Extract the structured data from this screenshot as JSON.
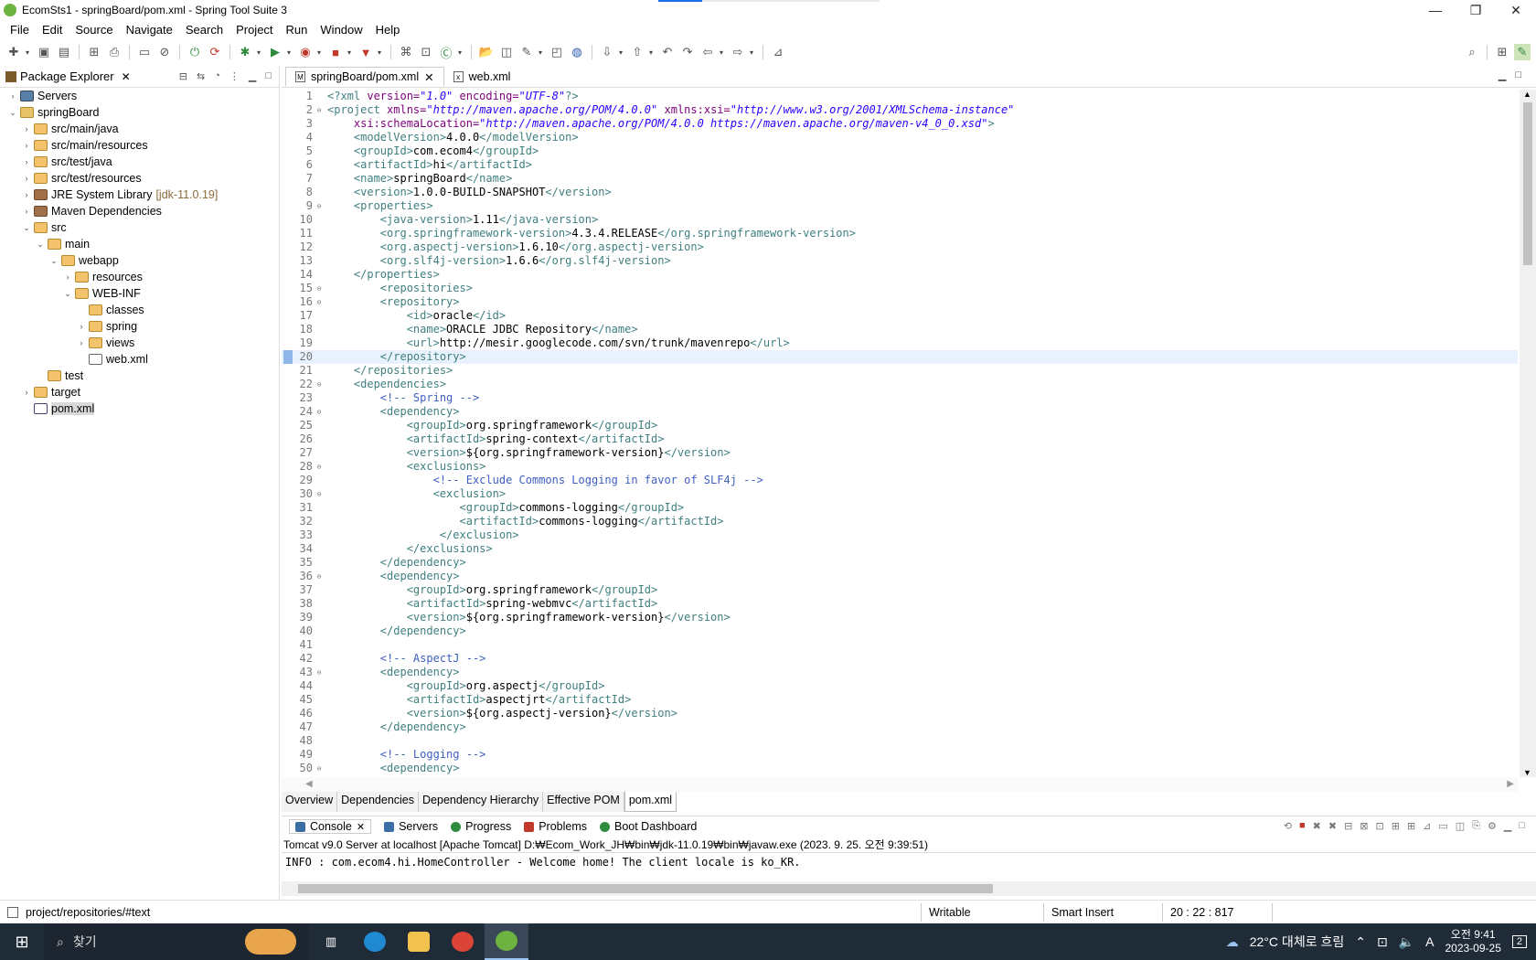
{
  "window": {
    "title": "EcomSts1 - springBoard/pom.xml - Spring Tool Suite 3"
  },
  "menu": [
    "File",
    "Edit",
    "Source",
    "Navigate",
    "Search",
    "Project",
    "Run",
    "Window",
    "Help"
  ],
  "package_explorer": {
    "title": "Package Explorer",
    "tree": [
      {
        "label": "Servers",
        "indent": 0,
        "arrow": "›",
        "icon": "srv"
      },
      {
        "label": "springBoard",
        "indent": 0,
        "arrow": "⌄",
        "icon": "proj"
      },
      {
        "label": "src/main/java",
        "indent": 1,
        "arrow": "›",
        "icon": "folder"
      },
      {
        "label": "src/main/resources",
        "indent": 1,
        "arrow": "›",
        "icon": "folder"
      },
      {
        "label": "src/test/java",
        "indent": 1,
        "arrow": "›",
        "icon": "folder"
      },
      {
        "label": "src/test/resources",
        "indent": 1,
        "arrow": "›",
        "icon": "folder"
      },
      {
        "label": "JRE System Library",
        "extra": "[jdk-11.0.19]",
        "indent": 1,
        "arrow": "›",
        "icon": "lib"
      },
      {
        "label": "Maven Dependencies",
        "indent": 1,
        "arrow": "›",
        "icon": "lib"
      },
      {
        "label": "src",
        "indent": 1,
        "arrow": "⌄",
        "icon": "folder"
      },
      {
        "label": "main",
        "indent": 2,
        "arrow": "⌄",
        "icon": "folder"
      },
      {
        "label": "webapp",
        "indent": 3,
        "arrow": "⌄",
        "icon": "folder"
      },
      {
        "label": "resources",
        "indent": 4,
        "arrow": "›",
        "icon": "folder"
      },
      {
        "label": "WEB-INF",
        "indent": 4,
        "arrow": "⌄",
        "icon": "folder"
      },
      {
        "label": "classes",
        "indent": 5,
        "arrow": "",
        "icon": "folder"
      },
      {
        "label": "spring",
        "indent": 5,
        "arrow": "›",
        "icon": "folder"
      },
      {
        "label": "views",
        "indent": 5,
        "arrow": "›",
        "icon": "folder"
      },
      {
        "label": "web.xml",
        "indent": 5,
        "arrow": "",
        "icon": "xml"
      },
      {
        "label": "test",
        "indent": 2,
        "arrow": "",
        "icon": "folder"
      },
      {
        "label": "target",
        "indent": 1,
        "arrow": "›",
        "icon": "folder"
      },
      {
        "label": "pom.xml",
        "indent": 1,
        "arrow": "",
        "icon": "mvn",
        "selected": true
      }
    ]
  },
  "editor": {
    "tabs": [
      {
        "label": "springBoard/pom.xml",
        "active": true,
        "close": "✕"
      },
      {
        "label": "web.xml",
        "active": false,
        "close": ""
      }
    ],
    "current_line": 20,
    "lines": [
      {
        "n": "1",
        "f": "",
        "s": [
          [
            "t",
            "<?xml "
          ],
          [
            "a",
            "version="
          ],
          [
            "v",
            "\"1.0\""
          ],
          [
            "a",
            " encoding="
          ],
          [
            "v",
            "\"UTF-8\""
          ],
          [
            "t",
            "?>"
          ]
        ]
      },
      {
        "n": "2",
        "f": "⊖",
        "s": [
          [
            "t",
            "<project "
          ],
          [
            "a",
            "xmlns="
          ],
          [
            "v",
            "\"http://maven.apache.org/POM/4.0.0\""
          ],
          [
            "a",
            " xmlns:xsi="
          ],
          [
            "v",
            "\"http://www.w3.org/2001/XMLSchema-instance\""
          ]
        ]
      },
      {
        "n": "3",
        "f": "",
        "s": [
          [
            "a",
            "    xsi:schemaLocation="
          ],
          [
            "v",
            "\"http://maven.apache.org/POM/4.0.0 https://maven.apache.org/maven-v4_0_0.xsd\""
          ],
          [
            "t",
            ">"
          ]
        ]
      },
      {
        "n": "4",
        "f": "",
        "s": [
          [
            "t",
            "    <modelVersion>"
          ],
          [
            "x",
            "4.0.0"
          ],
          [
            "t",
            "</modelVersion>"
          ]
        ]
      },
      {
        "n": "5",
        "f": "",
        "s": [
          [
            "t",
            "    <groupId>"
          ],
          [
            "x",
            "com.ecom4"
          ],
          [
            "t",
            "</groupId>"
          ]
        ]
      },
      {
        "n": "6",
        "f": "",
        "s": [
          [
            "t",
            "    <artifactId>"
          ],
          [
            "x",
            "hi"
          ],
          [
            "t",
            "</artifactId>"
          ]
        ]
      },
      {
        "n": "7",
        "f": "",
        "s": [
          [
            "t",
            "    <name>"
          ],
          [
            "x",
            "springBoard"
          ],
          [
            "t",
            "</name>"
          ]
        ]
      },
      {
        "n": "8",
        "f": "",
        "s": [
          [
            "t",
            "    <version>"
          ],
          [
            "x",
            "1.0.0-BUILD-SNAPSHOT"
          ],
          [
            "t",
            "</version>"
          ]
        ]
      },
      {
        "n": "9",
        "f": "⊖",
        "s": [
          [
            "t",
            "    <properties>"
          ]
        ]
      },
      {
        "n": "10",
        "f": "",
        "s": [
          [
            "t",
            "        <java-version>"
          ],
          [
            "x",
            "1.11"
          ],
          [
            "t",
            "</java-version>"
          ]
        ]
      },
      {
        "n": "11",
        "f": "",
        "s": [
          [
            "t",
            "        <org.springframework-version>"
          ],
          [
            "x",
            "4.3.4.RELEASE"
          ],
          [
            "t",
            "</org.springframework-version>"
          ]
        ]
      },
      {
        "n": "12",
        "f": "",
        "s": [
          [
            "t",
            "        <org.aspectj-version>"
          ],
          [
            "x",
            "1.6.10"
          ],
          [
            "t",
            "</org.aspectj-version>"
          ]
        ]
      },
      {
        "n": "13",
        "f": "",
        "s": [
          [
            "t",
            "        <org.slf4j-version>"
          ],
          [
            "x",
            "1.6.6"
          ],
          [
            "t",
            "</org.slf4j-version>"
          ]
        ]
      },
      {
        "n": "14",
        "f": "",
        "s": [
          [
            "t",
            "    </properties>"
          ]
        ]
      },
      {
        "n": "15",
        "f": "⊖",
        "s": [
          [
            "t",
            "        <repositories>"
          ]
        ]
      },
      {
        "n": "16",
        "f": "⊖",
        "s": [
          [
            "t",
            "        <repository>"
          ]
        ]
      },
      {
        "n": "17",
        "f": "",
        "s": [
          [
            "t",
            "            <id>"
          ],
          [
            "x",
            "oracle"
          ],
          [
            "t",
            "</id>"
          ]
        ]
      },
      {
        "n": "18",
        "f": "",
        "s": [
          [
            "t",
            "            <name>"
          ],
          [
            "x",
            "ORACLE JDBC Repository"
          ],
          [
            "t",
            "</name>"
          ]
        ]
      },
      {
        "n": "19",
        "f": "",
        "s": [
          [
            "t",
            "            <url>"
          ],
          [
            "x",
            "http://mesir.googlecode.com/svn/trunk/mavenrepo"
          ],
          [
            "t",
            "</url>"
          ]
        ]
      },
      {
        "n": "20",
        "f": "",
        "s": [
          [
            "t",
            "        </repository>"
          ]
        ]
      },
      {
        "n": "21",
        "f": "",
        "s": [
          [
            "t",
            "    </repositories>"
          ]
        ]
      },
      {
        "n": "22",
        "f": "⊖",
        "s": [
          [
            "t",
            "    <dependencies>"
          ]
        ]
      },
      {
        "n": "23",
        "f": "",
        "s": [
          [
            "c",
            "        <!-- Spring -->"
          ]
        ]
      },
      {
        "n": "24",
        "f": "⊖",
        "s": [
          [
            "t",
            "        <dependency>"
          ]
        ]
      },
      {
        "n": "25",
        "f": "",
        "s": [
          [
            "t",
            "            <groupId>"
          ],
          [
            "x",
            "org.springframework"
          ],
          [
            "t",
            "</groupId>"
          ]
        ]
      },
      {
        "n": "26",
        "f": "",
        "s": [
          [
            "t",
            "            <artifactId>"
          ],
          [
            "x",
            "spring-context"
          ],
          [
            "t",
            "</artifactId>"
          ]
        ]
      },
      {
        "n": "27",
        "f": "",
        "s": [
          [
            "t",
            "            <version>"
          ],
          [
            "x",
            "${org.springframework-version}"
          ],
          [
            "t",
            "</version>"
          ]
        ]
      },
      {
        "n": "28",
        "f": "⊖",
        "s": [
          [
            "t",
            "            <exclusions>"
          ]
        ]
      },
      {
        "n": "29",
        "f": "",
        "s": [
          [
            "c",
            "                <!-- Exclude Commons Logging in favor of SLF4j -->"
          ]
        ]
      },
      {
        "n": "30",
        "f": "⊖",
        "s": [
          [
            "t",
            "                <exclusion>"
          ]
        ]
      },
      {
        "n": "31",
        "f": "",
        "s": [
          [
            "t",
            "                    <groupId>"
          ],
          [
            "x",
            "commons-logging"
          ],
          [
            "t",
            "</groupId>"
          ]
        ]
      },
      {
        "n": "32",
        "f": "",
        "s": [
          [
            "t",
            "                    <artifactId>"
          ],
          [
            "x",
            "commons-logging"
          ],
          [
            "t",
            "</artifactId>"
          ]
        ]
      },
      {
        "n": "33",
        "f": "",
        "s": [
          [
            "t",
            "                 </exclusion>"
          ]
        ]
      },
      {
        "n": "34",
        "f": "",
        "s": [
          [
            "t",
            "            </exclusions>"
          ]
        ]
      },
      {
        "n": "35",
        "f": "",
        "s": [
          [
            "t",
            "        </dependency>"
          ]
        ]
      },
      {
        "n": "36",
        "f": "⊖",
        "s": [
          [
            "t",
            "        <dependency>"
          ]
        ]
      },
      {
        "n": "37",
        "f": "",
        "s": [
          [
            "t",
            "            <groupId>"
          ],
          [
            "x",
            "org.springframework"
          ],
          [
            "t",
            "</groupId>"
          ]
        ]
      },
      {
        "n": "38",
        "f": "",
        "s": [
          [
            "t",
            "            <artifactId>"
          ],
          [
            "x",
            "spring-webmvc"
          ],
          [
            "t",
            "</artifactId>"
          ]
        ]
      },
      {
        "n": "39",
        "f": "",
        "s": [
          [
            "t",
            "            <version>"
          ],
          [
            "x",
            "${org.springframework-version}"
          ],
          [
            "t",
            "</version>"
          ]
        ]
      },
      {
        "n": "40",
        "f": "",
        "s": [
          [
            "t",
            "        </dependency>"
          ]
        ]
      },
      {
        "n": "41",
        "f": "",
        "s": []
      },
      {
        "n": "42",
        "f": "",
        "s": [
          [
            "c",
            "        <!-- AspectJ -->"
          ]
        ]
      },
      {
        "n": "43",
        "f": "⊖",
        "s": [
          [
            "t",
            "        <dependency>"
          ]
        ]
      },
      {
        "n": "44",
        "f": "",
        "s": [
          [
            "t",
            "            <groupId>"
          ],
          [
            "x",
            "org.aspectj"
          ],
          [
            "t",
            "</groupId>"
          ]
        ]
      },
      {
        "n": "45",
        "f": "",
        "s": [
          [
            "t",
            "            <artifactId>"
          ],
          [
            "x",
            "aspectjrt"
          ],
          [
            "t",
            "</artifactId>"
          ]
        ]
      },
      {
        "n": "46",
        "f": "",
        "s": [
          [
            "t",
            "            <version>"
          ],
          [
            "x",
            "${org.aspectj-version}"
          ],
          [
            "t",
            "</version>"
          ]
        ]
      },
      {
        "n": "47",
        "f": "",
        "s": [
          [
            "t",
            "        </dependency>"
          ]
        ]
      },
      {
        "n": "48",
        "f": "",
        "s": []
      },
      {
        "n": "49",
        "f": "",
        "s": [
          [
            "c",
            "        <!-- Logging -->"
          ]
        ]
      },
      {
        "n": "50",
        "f": "⊖",
        "s": [
          [
            "t",
            "        <dependency>"
          ]
        ]
      }
    ],
    "bottom_tabs": [
      "Overview",
      "Dependencies",
      "Dependency Hierarchy",
      "Effective POM",
      "pom.xml"
    ]
  },
  "console": {
    "tabs": [
      "Console",
      "Servers",
      "Progress",
      "Problems",
      "Boot Dashboard"
    ],
    "server_info": "Tomcat v9.0 Server at localhost [Apache Tomcat] D:₩Ecom_Work_JH₩bin₩jdk-11.0.19₩bin₩javaw.exe  (2023. 9. 25. 오전 9:39:51)",
    "output": "INFO : com.ecom4.hi.HomeController - Welcome home! The client locale is ko_KR."
  },
  "status": {
    "path": "project/repositories/#text",
    "mode": "Writable",
    "insert": "Smart Insert",
    "position": "20 : 22 : 817"
  },
  "taskbar": {
    "search": "찾기",
    "weather": "22°C  대체로 흐림",
    "time": "오전 9:41",
    "date": "2023-09-25",
    "notif": "2",
    "ime": "A"
  }
}
